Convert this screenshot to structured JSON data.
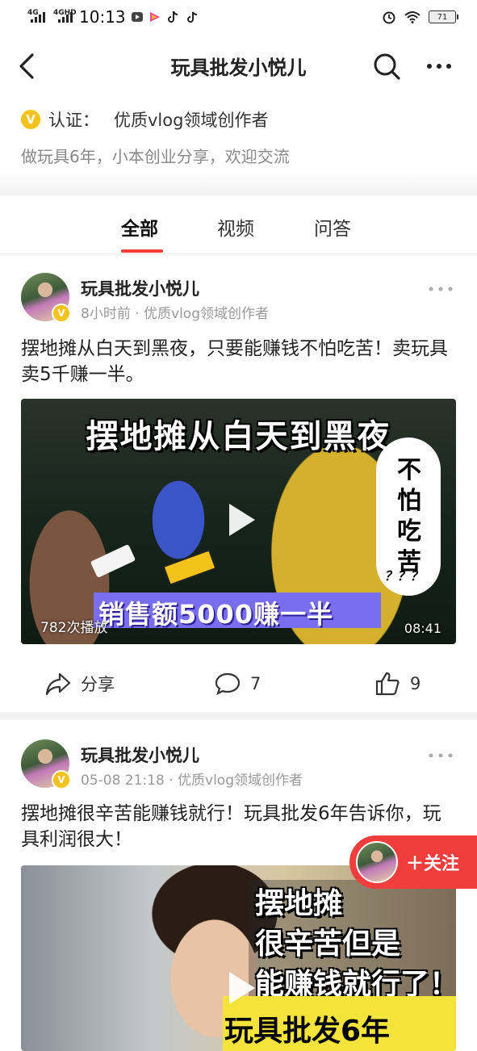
{
  "status_bar": {
    "net1": "4G",
    "net2": "4GHD",
    "time": "10:13",
    "battery": "71"
  },
  "header": {
    "title": "玩具批发小悦儿"
  },
  "profile": {
    "verify_label": "认证：",
    "verify_value": "优质vlog领域创作者",
    "bio": "做玩具6年，小本创业分享，欢迎交流"
  },
  "tabs": [
    {
      "label": "全部",
      "active": true
    },
    {
      "label": "视频",
      "active": false
    },
    {
      "label": "问答",
      "active": false
    }
  ],
  "posts": [
    {
      "author": "玩具批发小悦儿",
      "meta": "8小时前 · 优质vlog领域创作者",
      "text": "摆地摊从白天到黑夜，只要能赚钱不怕吃苦！卖玩具卖5千赚一半。",
      "video": {
        "headline": "摆地摊从白天到黑夜",
        "bubble_text": "不怕吃苦",
        "bubble_q": "？？？",
        "banner": "销售额5000赚一半",
        "plays": "782次播放",
        "duration": "08:41"
      },
      "actions": {
        "share_label": "分享",
        "comments": "7",
        "likes": "9"
      }
    },
    {
      "author": "玩具批发小悦儿",
      "meta": "05-08 21:18 · 优质vlog领域创作者",
      "text": "摆地摊很辛苦能赚钱就行！玩具批发6年告诉你，玩具利润很大！",
      "video": {
        "line1": "摆地摊",
        "line2": "很辛苦但是",
        "line3": "能赚钱就行了！",
        "line4": "玩具批发6年"
      }
    }
  ],
  "follow_button": {
    "label": "＋关注"
  }
}
